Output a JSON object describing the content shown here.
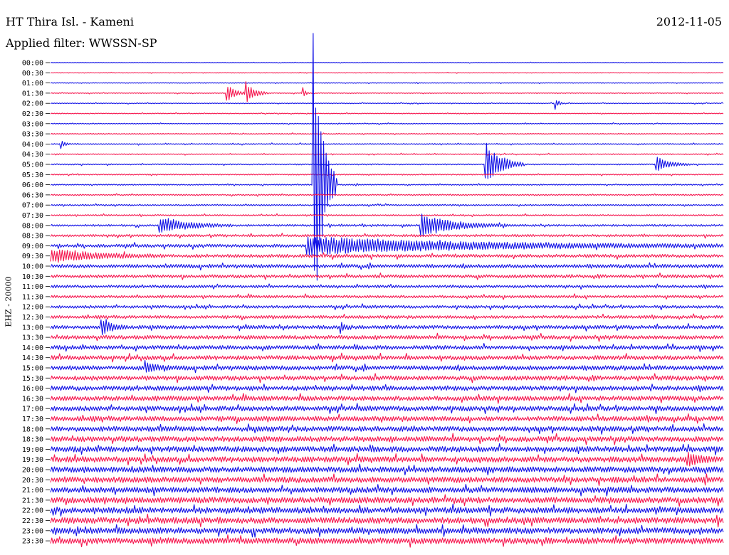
{
  "header": {
    "station": "HT Thira Isl. - Kameni",
    "date": "2012-11-05",
    "filter": "Applied filter: WWSSN-SP",
    "channel": "EHZ - 20000"
  },
  "colors": {
    "trace_a": "#1212e6",
    "trace_b": "#f5174f",
    "background": "#ffffff",
    "text": "#000000"
  },
  "chart_data": {
    "type": "helicorder",
    "row_labels": [
      "00:00",
      "00:30",
      "01:00",
      "01:30",
      "02:00",
      "02:30",
      "03:00",
      "03:30",
      "04:00",
      "04:30",
      "05:00",
      "05:30",
      "06:00",
      "06:30",
      "07:00",
      "07:30",
      "08:00",
      "08:30",
      "09:00",
      "09:30",
      "10:00",
      "10:30",
      "11:00",
      "11:30",
      "12:00",
      "12:30",
      "13:00",
      "13:30",
      "14:00",
      "14:30",
      "15:00",
      "15:30",
      "16:00",
      "16:30",
      "17:00",
      "17:30",
      "18:00",
      "18:30",
      "19:00",
      "19:30",
      "20:00",
      "20:30",
      "21:00",
      "21:30",
      "22:00",
      "22:30",
      "23:00",
      "23:30"
    ],
    "row_colors": [
      "trace_a",
      "trace_b"
    ],
    "noise_level_by_row": [
      0.3,
      0.3,
      0.35,
      0.4,
      0.4,
      0.4,
      0.45,
      0.45,
      0.55,
      0.5,
      0.6,
      0.6,
      0.6,
      0.65,
      0.7,
      0.7,
      1.0,
      1.2,
      1.6,
      1.6,
      1.8,
      1.6,
      1.4,
      1.3,
      1.4,
      1.5,
      1.8,
      1.9,
      2.0,
      2.1,
      2.2,
      2.2,
      2.3,
      2.3,
      2.4,
      2.4,
      2.5,
      2.6,
      2.7,
      2.7,
      2.8,
      2.8,
      2.8,
      2.9,
      2.9,
      3.0,
      3.0,
      3.0
    ],
    "events": [
      {
        "row": "01:30",
        "position": 0.26,
        "amplitude": 14,
        "duration": 0.035
      },
      {
        "row": "01:30",
        "position": 0.29,
        "amplitude": 16,
        "duration": 0.035
      },
      {
        "row": "01:30",
        "position": 0.375,
        "amplitude": 8,
        "duration": 0.01
      },
      {
        "row": "02:00",
        "position": 0.75,
        "amplitude": 9,
        "duration": 0.012
      },
      {
        "row": "04:00",
        "position": 0.015,
        "amplitude": 7,
        "duration": 0.015
      },
      {
        "row": "05:00",
        "position": 0.645,
        "amplitude": 34,
        "duration": 0.06
      },
      {
        "row": "05:00",
        "position": 0.9,
        "amplitude": 12,
        "duration": 0.05
      },
      {
        "row": "06:00",
        "position": 0.39,
        "amplitude": 225,
        "duration": 0.035
      },
      {
        "row": "08:00",
        "position": 0.16,
        "amplitude": 12,
        "duration": 0.11
      },
      {
        "row": "08:00",
        "position": 0.55,
        "amplitude": 16,
        "duration": 0.13
      },
      {
        "row": "09:00",
        "position": 0.38,
        "amplitude": 12,
        "duration": 0.62
      },
      {
        "row": "09:30",
        "position": 0.0,
        "amplitude": 9,
        "duration": 0.17
      },
      {
        "row": "13:00",
        "position": 0.075,
        "amplitude": 11,
        "duration": 0.04
      },
      {
        "row": "13:00",
        "position": 0.43,
        "amplitude": 8,
        "duration": 0.02
      },
      {
        "row": "15:00",
        "position": 0.14,
        "amplitude": 8,
        "duration": 0.04
      },
      {
        "row": "19:30",
        "position": 0.945,
        "amplitude": 10,
        "duration": 0.05
      }
    ]
  }
}
